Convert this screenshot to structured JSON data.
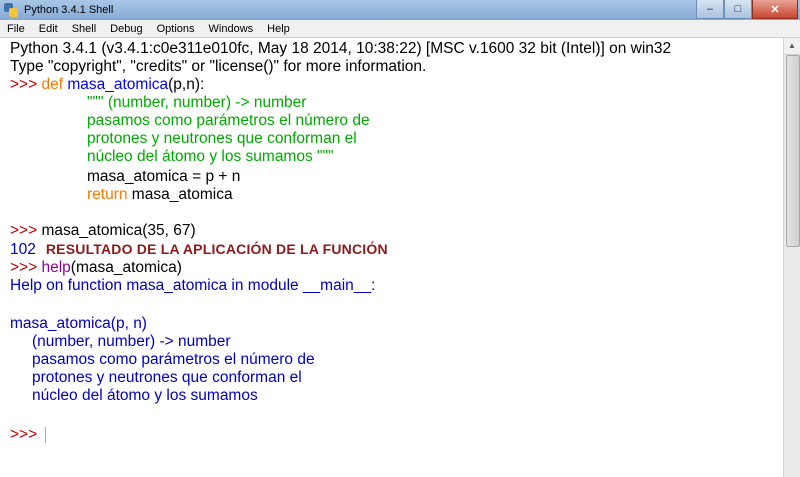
{
  "window": {
    "title": "Python 3.4.1 Shell",
    "minimize": "–",
    "maximize": "□",
    "close": "✕"
  },
  "menu": [
    "File",
    "Edit",
    "Shell",
    "Debug",
    "Options",
    "Windows",
    "Help"
  ],
  "shell": {
    "banner1": "Python 3.4.1 (v3.4.1:c0e311e010fc, May 18 2014, 10:38:22) [MSC v.1600 32 bit (Intel)] on win32",
    "banner2": "Type \"copyright\", \"credits\" or \"license()\" for more information.",
    "prompt": ">>> ",
    "def_kw": "def",
    "def_name": "masa_atomica",
    "def_args": "(p,n):",
    "doc1": "\"\"\" (number, number) -> number",
    "doc2": "pasamos como parámetros el número de",
    "doc3": "protones y neutrones que conforman el",
    "doc4": "núcleo del átomo y los sumamos \"\"\"",
    "body1": "masa_atomica = p + n",
    "return_kw": "return",
    "return_val": " masa_atomica",
    "call": "masa_atomica(35, 67)",
    "result": "102",
    "annotation": "RESULTADO DE LA APLICACIÓN DE LA FUNCIÓN",
    "help_kw": "help",
    "help_args": "(masa_atomica)",
    "help1": "Help on function masa_atomica in module __main__:",
    "help2": "masa_atomica(p, n)",
    "help3": "(number, number) -> number",
    "help4": "pasamos como parámetros el número de",
    "help5": "protones y neutrones que conforman el",
    "help6": "núcleo del átomo y los sumamos"
  },
  "colors": {
    "keyword": "#ff7700",
    "prompt": "#c00000",
    "string": "#00aa00",
    "output": "#0000c0",
    "builtin": "#900090"
  }
}
